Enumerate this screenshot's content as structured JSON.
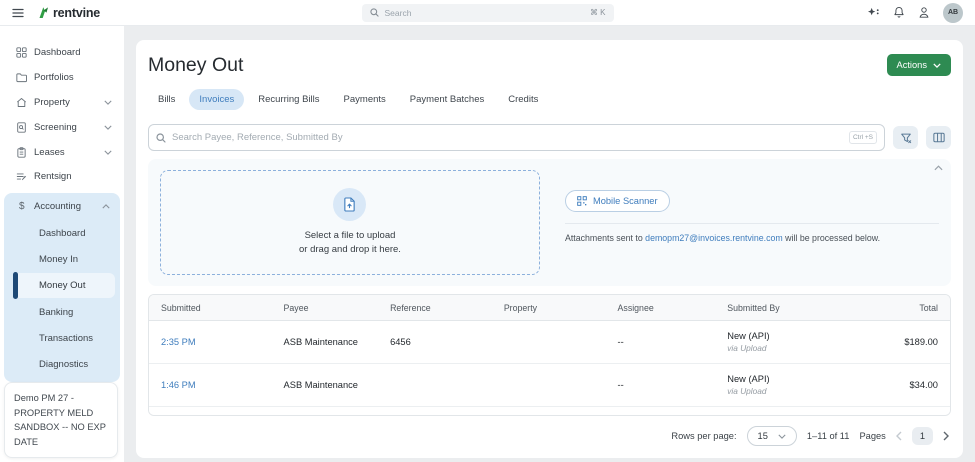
{
  "topbar": {
    "logo_text": "rentvine",
    "search_placeholder": "Search",
    "search_shortcut": "⌘ K",
    "avatar_initials": "AB"
  },
  "sidebar": {
    "items": [
      {
        "label": "Dashboard"
      },
      {
        "label": "Portfolios"
      },
      {
        "label": "Property"
      },
      {
        "label": "Screening"
      },
      {
        "label": "Leases"
      },
      {
        "label": "Rentsign"
      }
    ],
    "accounting": {
      "label": "Accounting",
      "subitems": [
        {
          "label": "Dashboard"
        },
        {
          "label": "Money In"
        },
        {
          "label": "Money Out",
          "active": true
        },
        {
          "label": "Banking"
        },
        {
          "label": "Transactions"
        },
        {
          "label": "Diagnostics"
        }
      ]
    },
    "demo_note": "Demo PM 27 - PROPERTY MELD SANDBOX -- NO EXP DATE"
  },
  "main": {
    "title": "Money Out",
    "actions_label": "Actions",
    "tabs": [
      {
        "label": "Bills"
      },
      {
        "label": "Invoices",
        "active": true
      },
      {
        "label": "Recurring Bills"
      },
      {
        "label": "Payments"
      },
      {
        "label": "Payment Batches"
      },
      {
        "label": "Credits"
      }
    ],
    "search_placeholder": "Search Payee, Reference, Submitted By",
    "search_shortcut": "Ctrl +S",
    "upload_panel": {
      "dropzone_line1": "Select a file to upload",
      "dropzone_line2": "or drag and drop it here.",
      "mobile_scanner_label": "Mobile Scanner",
      "attachments_prefix": "Attachments sent to",
      "attachments_email": "demopm27@invoices.rentvine.com",
      "attachments_suffix": "will be processed below."
    },
    "table": {
      "headers": [
        "Submitted",
        "Payee",
        "Reference",
        "Property",
        "Assignee",
        "Submitted By",
        "Total"
      ],
      "rows": [
        {
          "submitted": "2:35 PM",
          "payee": "ASB Maintenance",
          "reference": "6456",
          "property": "",
          "assignee": "--",
          "submitted_by": "New (API)",
          "submitted_via": "via Upload",
          "total": "$189.00"
        },
        {
          "submitted": "1:46 PM",
          "payee": "ASB Maintenance",
          "reference": "",
          "property": "",
          "assignee": "--",
          "submitted_by": "New (API)",
          "submitted_via": "via Upload",
          "total": "$34.00"
        }
      ]
    },
    "pagination": {
      "rows_per_page_label": "Rows per page:",
      "rows_per_page_value": "15",
      "range": "1–11 of 11",
      "pages_label": "Pages",
      "current_page": "1"
    }
  },
  "colors": {
    "accent_green": "#2e8b52",
    "link_blue": "#3f7dbd",
    "active_tab_bg": "#d7e7f6",
    "sidebar_section_bg": "#dcebf7",
    "active_nav_indicator": "#1e4976"
  }
}
